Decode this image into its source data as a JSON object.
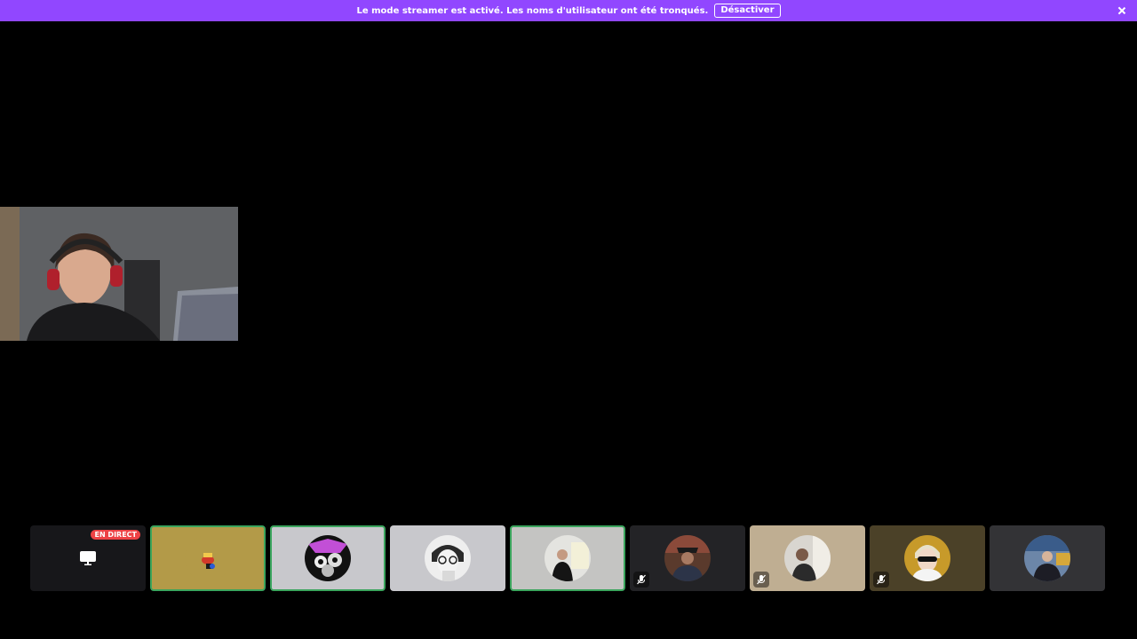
{
  "banner": {
    "message": "Le mode streamer est activé. Les noms d'utilisateur ont été tronqués.",
    "disable_label": "Désactiver",
    "close_icon": "close-icon",
    "color": "#9147ff"
  },
  "main_video": {
    "description_icon": "webcam-feed"
  },
  "tiles": [
    {
      "type": "stream",
      "badge": "EN DIRECT",
      "icon": "screen-share-icon",
      "background": "#17171a"
    },
    {
      "type": "avatar",
      "background": "#b39a48",
      "speaking": true,
      "muted": false
    },
    {
      "type": "avatar",
      "background": "#c8c8cc",
      "speaking": true,
      "muted": false
    },
    {
      "type": "avatar",
      "background": "#c8c8cc",
      "speaking": false,
      "muted": false
    },
    {
      "type": "avatar",
      "background": "#c4c4c2",
      "speaking": true,
      "muted": false
    },
    {
      "type": "avatar",
      "background": "#232326",
      "speaking": false,
      "muted": true
    },
    {
      "type": "avatar",
      "background": "#bfae92",
      "speaking": false,
      "muted": true
    },
    {
      "type": "avatar",
      "background": "#4b4128",
      "speaking": false,
      "muted": true
    },
    {
      "type": "avatar",
      "background": "#333336",
      "speaking": false,
      "muted": false
    }
  ],
  "colors": {
    "speaking_ring": "#3ba55d",
    "live_badge": "#ed4245"
  }
}
